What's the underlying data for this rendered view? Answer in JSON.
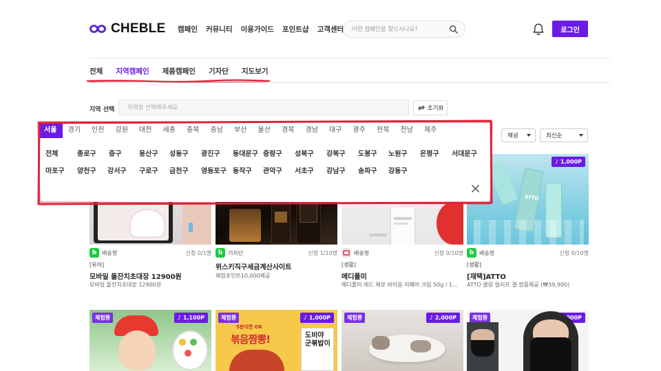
{
  "header": {
    "logo_text": "CHEBLE",
    "nav": [
      "캠페인",
      "커뮤니티",
      "이용가이드",
      "포인트샵",
      "고객센터"
    ],
    "search_placeholder": "어떤 캠페인을 찾으시나요?",
    "login_label": "로그인"
  },
  "tabs": [
    {
      "label": "전체",
      "active": false
    },
    {
      "label": "지역캠페인",
      "active": true
    },
    {
      "label": "제품캠페인",
      "active": false
    },
    {
      "label": "기자단",
      "active": false
    },
    {
      "label": "지도보기",
      "active": false
    }
  ],
  "region": {
    "label": "지역 선택",
    "placeholder": "지역을 선택해주세요.",
    "reset_label": "초기화"
  },
  "filters": {
    "channel": "채널",
    "sort": "최신순"
  },
  "cities": [
    "서울",
    "경기",
    "인천",
    "강원",
    "대전",
    "세종",
    "충북",
    "충남",
    "부산",
    "울산",
    "경북",
    "경남",
    "대구",
    "광주",
    "전북",
    "전남",
    "제주"
  ],
  "districts_row1": [
    "전체",
    "종로구",
    "중구",
    "용산구",
    "성동구",
    "광진구",
    "동대문구",
    "중랑구",
    "성북구",
    "강북구",
    "도봉구",
    "노원구",
    "은평구",
    "서대문구"
  ],
  "districts_row2": [
    "마포구",
    "양천구",
    "강서구",
    "구로구",
    "금천구",
    "영등포구",
    "동작구",
    "관악구",
    "서초구",
    "강남구",
    "송파구",
    "강동구"
  ],
  "cards": [
    {
      "channel": "배송형",
      "count": "신청 0/1명",
      "category": "[유아]",
      "title": "모바일 돌잔치초대장 12900원",
      "desc": "모바일 돌잔치초대장 12900원",
      "logo": "b"
    },
    {
      "channel": "기자단",
      "count": "신청 1/10명",
      "category": "",
      "title": "위스키직구세금계산사이트",
      "desc": "체험포인트10,000제공",
      "logo": "b"
    },
    {
      "channel": "배송형",
      "count": "신청 0/10명",
      "category": "[생활]",
      "title": "메디폴미",
      "desc": "메디폴미 레드 제로 바이옴 리페어 크림 50g / 1...",
      "logo": "h"
    },
    {
      "channel": "배송형",
      "count": "신청 0/10명",
      "category": "[생활]",
      "title": "[재택]ATTO",
      "desc": "ATTO 클링 릴리프 겔 정품제공 (₩39,900)",
      "logo": "b",
      "points": "1,000P"
    }
  ],
  "cards_row2": [
    {
      "type": "체험쭝",
      "points": "1,100P"
    },
    {
      "type": "체험쭝",
      "points": "1,000P"
    },
    {
      "type": "체험쭝",
      "points": "2,000P"
    },
    {
      "type": "체험쭝",
      "points": "20,000P"
    }
  ],
  "image_text": {
    "atto": "ATTO",
    "ramen_top": "5분이면 OK",
    "ramen_main": "볶음짬뽕!",
    "ramen_side1": "도비야",
    "ramen_side2": "군볶밥이"
  },
  "colors": {
    "accent": "#6a1be5",
    "annotation": "#e0203a",
    "naver_green": "#1fcc3f"
  }
}
